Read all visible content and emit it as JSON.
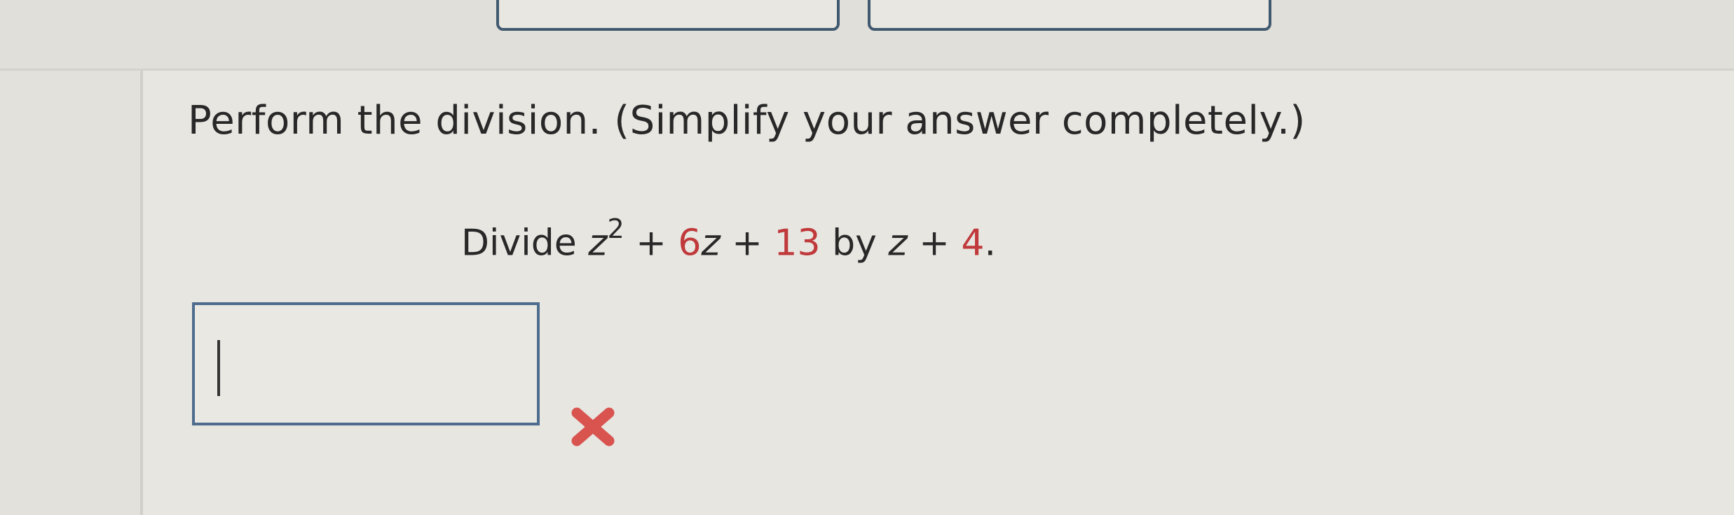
{
  "header": {
    "buttons": [
      "",
      ""
    ]
  },
  "question": {
    "instructions": "Perform the division. (Simplify your answer completely.)",
    "problem": {
      "divide_label": "Divide",
      "dividend": {
        "var1": "z",
        "exp": "2",
        "plus1": "+",
        "coef_z": "6",
        "var2": "z",
        "plus2": "+",
        "const": "13"
      },
      "by_label": "by",
      "divisor": {
        "var": "z",
        "plus": "+",
        "const": "4"
      },
      "period": "."
    },
    "answer": {
      "value": "",
      "status_icon": "x-mark-icon",
      "status_color": "#d9534f"
    }
  }
}
